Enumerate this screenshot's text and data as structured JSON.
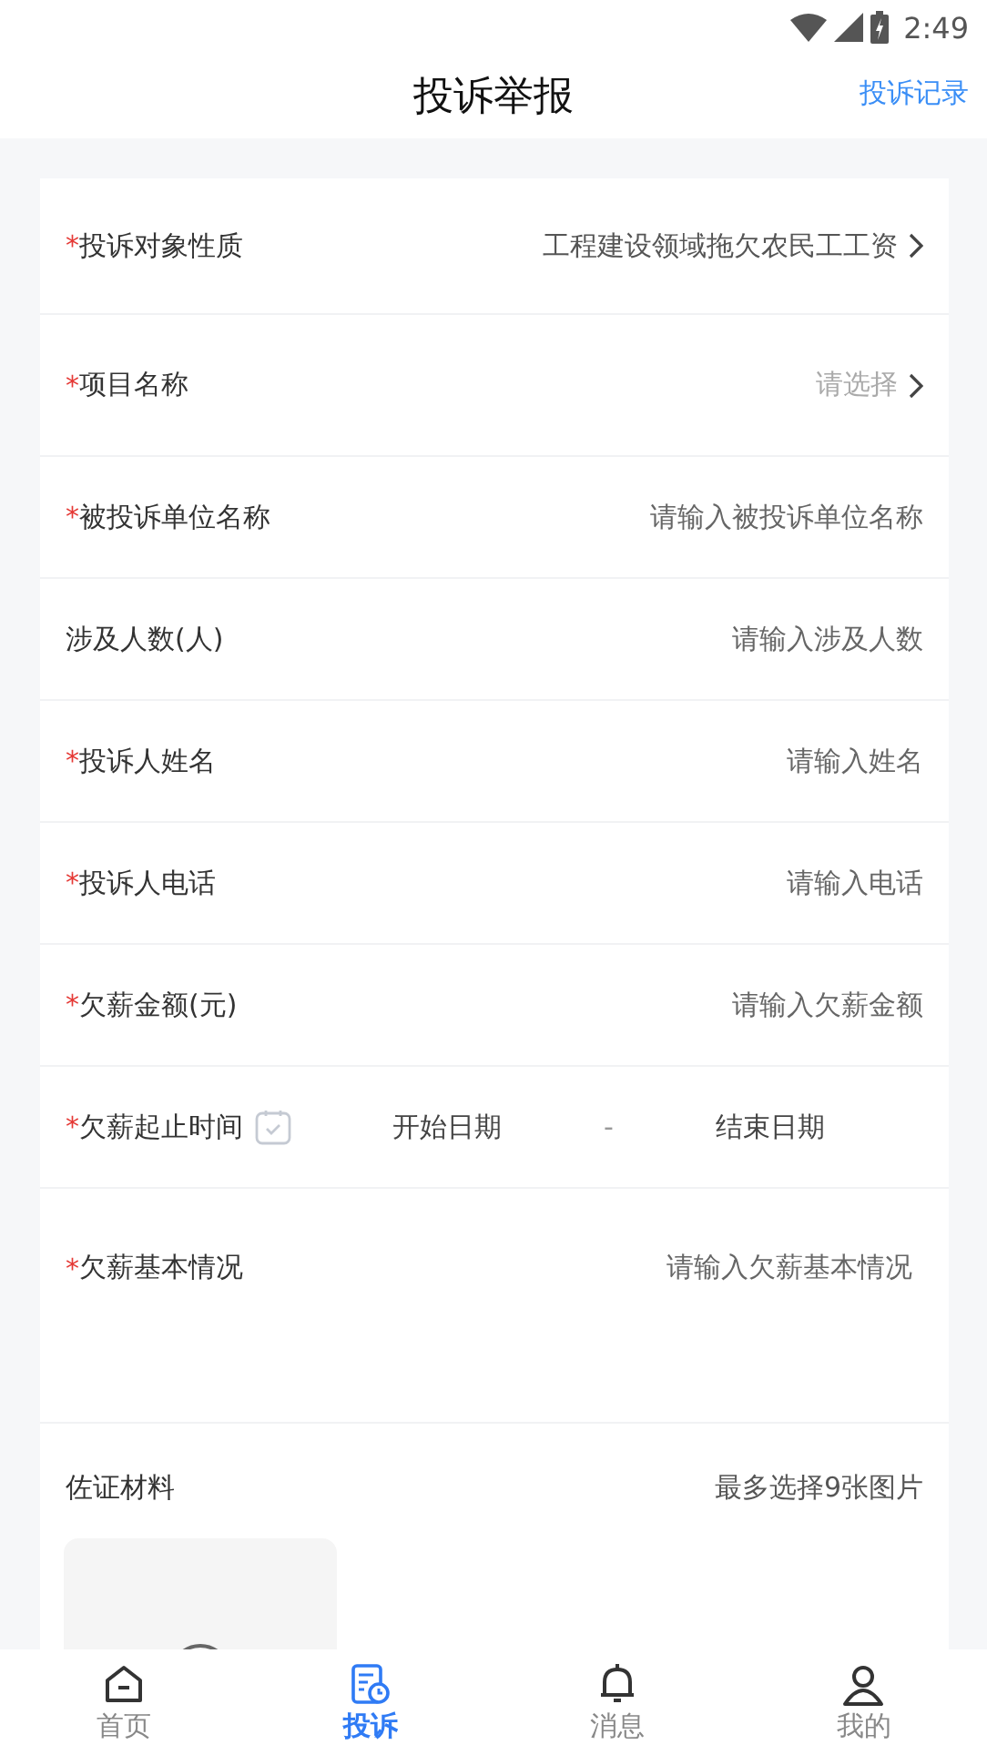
{
  "status_bar": {
    "time": "2:49"
  },
  "header": {
    "title": "投诉举报",
    "action": "投诉记录"
  },
  "form": {
    "fields": [
      {
        "kind": "select",
        "mark": "*",
        "label": "投诉对象性质",
        "value": "工程建设领域拖欠农民工工资"
      },
      {
        "kind": "select",
        "mark": "*",
        "label": "项目名称",
        "placeholder": "请选择"
      },
      {
        "kind": "input",
        "mark": "*",
        "label": "被投诉单位名称",
        "placeholder": "请输入被投诉单位名称"
      },
      {
        "kind": "input",
        "label": "涉及人数(人)",
        "placeholder": "请输入涉及人数"
      },
      {
        "kind": "input",
        "mark": "*",
        "label": "投诉人姓名",
        "placeholder": "请输入姓名"
      },
      {
        "kind": "input",
        "mark": "*",
        "label": "投诉人电话",
        "placeholder": "请输入电话"
      },
      {
        "kind": "input",
        "mark": "*",
        "label": "欠薪金额(元)",
        "placeholder": "请输入欠薪金额"
      },
      {
        "kind": "date",
        "mark": "*",
        "label": "欠薪起止时间",
        "start": "开始日期",
        "separator": "-",
        "end": "结束日期"
      },
      {
        "kind": "textarea",
        "mark": "*",
        "label": "欠薪基本情况",
        "placeholder": "请输入欠薪基本情况"
      }
    ]
  },
  "evidence": {
    "label": "佐证材料",
    "hint": "最多选择9张图片"
  },
  "tabs": [
    {
      "kind": "home",
      "label": "首页",
      "selected": false
    },
    {
      "kind": "complaint",
      "label": "投诉",
      "selected": true
    },
    {
      "kind": "message",
      "label": "消息",
      "selected": false
    },
    {
      "kind": "profile",
      "label": "我的",
      "selected": false
    }
  ]
}
